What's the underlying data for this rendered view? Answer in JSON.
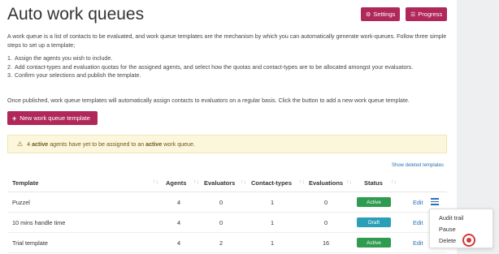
{
  "page": {
    "title": "Auto work queues",
    "buttons": {
      "settings": "Settings",
      "progress": "Progress"
    },
    "intro": "A work queue is a list of contacts to be evaluated, and work queue templates are the mechanism by which you can automatically generate work-queues. Follow three simple steps to set up a template;",
    "steps": [
      {
        "num": "1.",
        "text": "Assign the agents you wish to include."
      },
      {
        "num": "2.",
        "text": "Add contact-types and evaluation quotas for the assigned agents, and select how the quotas and contact-types are to be allocated amongst your evaluators."
      },
      {
        "num": "3.",
        "text": "Confirm your selections and publish the template."
      }
    ],
    "published_note": "Once published, work queue templates will automatically assign contacts to evaluators on a regular basis. Click the button to add a new work queue template.",
    "new_template_button": "New work queue template",
    "alert": {
      "count": "4",
      "word1": "active",
      "text1": "agents have yet to be assigned to an",
      "word2": "active",
      "text2": "work queue."
    },
    "show_deleted": "Show deleted templates"
  },
  "table": {
    "headers": {
      "template": "Template",
      "agents": "Agents",
      "evaluators": "Evaluators",
      "contact_types": "Contact-types",
      "evaluations": "Evaluations",
      "status": "Status"
    },
    "rows": [
      {
        "template": "Puzzel",
        "agents": "4",
        "evaluators": "0",
        "contact_types": "1",
        "evaluations": "0",
        "status": "Active",
        "edit": "Edit"
      },
      {
        "template": "10 mins handle time",
        "agents": "4",
        "evaluators": "0",
        "contact_types": "1",
        "evaluations": "0",
        "status": "Draft",
        "edit": "Edit"
      },
      {
        "template": "Trial template",
        "agents": "4",
        "evaluators": "2",
        "contact_types": "1",
        "evaluations": "16",
        "status": "Active",
        "edit": "Edit"
      }
    ]
  },
  "dropdown": {
    "items": [
      "Audit trail",
      "Pause",
      "Delete"
    ]
  },
  "colors": {
    "brand": "#b0275a",
    "active": "#2e9b4f",
    "draft": "#2aa0b6",
    "link": "#2a72b8"
  }
}
